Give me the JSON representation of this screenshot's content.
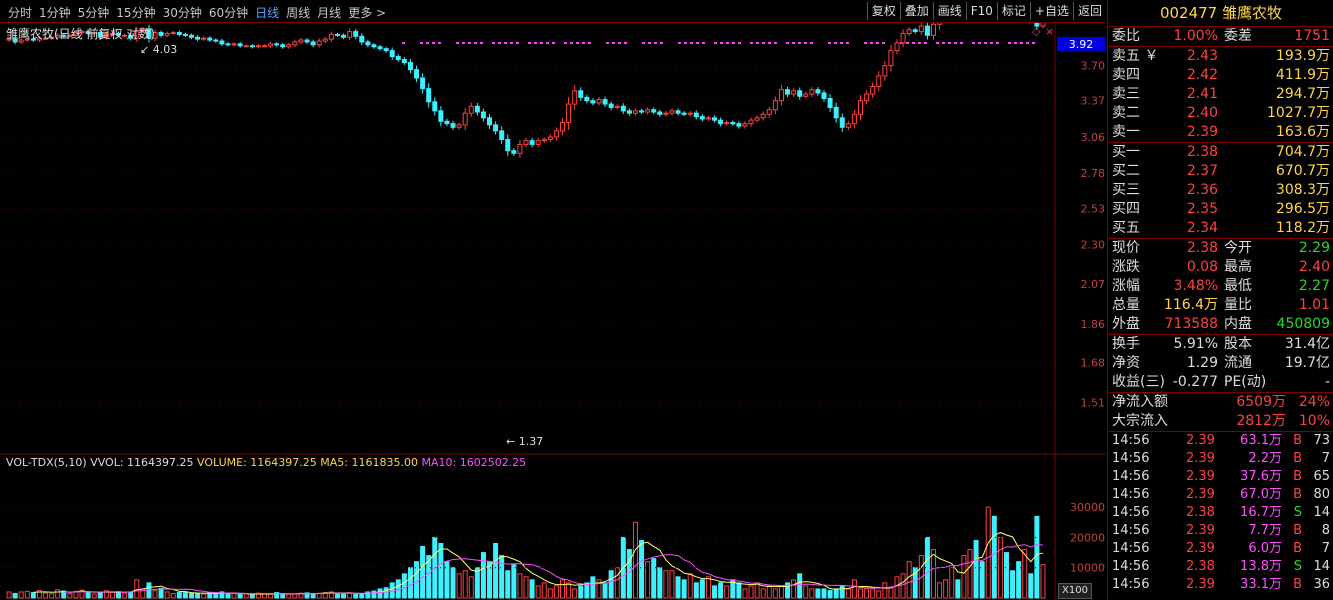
{
  "toolbar": {
    "periods": [
      "分时",
      "1分钟",
      "5分钟",
      "15分钟",
      "30分钟",
      "60分钟",
      "日线",
      "周线",
      "月线",
      "更多 >"
    ],
    "active": "日线",
    "buttons": [
      "复权",
      "叠加",
      "画线",
      "F10",
      "标记",
      "+自选",
      "返回"
    ]
  },
  "chart_label": "雏鹰农牧(日线 前复权 对数)",
  "price_axis": {
    "ticks": [
      "3.70",
      "3.37",
      "3.06",
      "2.78",
      "2.53",
      "2.30",
      "2.07",
      "1.86",
      "1.68",
      "1.51"
    ],
    "current_tag": "3.92"
  },
  "markers": {
    "high": "4.03",
    "low": "1.37"
  },
  "vol_label": {
    "name": "VOL-TDX(5,10)",
    "vvol": "VVOL: 1164397.25",
    "volume": "VOLUME: 1164397.25",
    "ma5": "MA5: 1161835.00",
    "ma10": "MA10: 1602502.25"
  },
  "vol_axis": {
    "ticks": [
      "30000",
      "20000",
      "10000"
    ],
    "multiplier": "X100"
  },
  "chart_data": {
    "type": "candlestick",
    "start": 3.96,
    "changes": [
      0.01,
      -0.03,
      0.02,
      0.01,
      -0.01,
      0.02,
      0,
      0.01,
      0.02,
      -0.01,
      0.01,
      0.03,
      0.01,
      -0.02,
      0.01,
      -0.05,
      0.03,
      0.01,
      -0.02,
      0,
      -0.03,
      0.08,
      0.02,
      -0.1,
      0.06,
      -0.03,
      0.02,
      0.01,
      -0.02,
      -0.01,
      -0.02,
      -0.02,
      0.01,
      -0.02,
      -0.01,
      -0.03,
      -0.01,
      0.01,
      -0.02,
      0,
      -0.01,
      0.01,
      0,
      0.02,
      -0.01,
      -0.02,
      0.02,
      0.03,
      0.02,
      -0.02,
      -0.03,
      0.04,
      0.02,
      0.05,
      -0.01,
      -0.02,
      0.06,
      -0.05,
      -0.06,
      -0.03,
      -0.02,
      -0.02,
      -0.02,
      -0.06,
      -0.03,
      -0.03,
      -0.07,
      -0.08,
      -0.1,
      -0.12,
      -0.08,
      -0.09,
      -0.02,
      -0.03,
      0.02,
      0.1,
      0.06,
      -0.05,
      -0.05,
      -0.06,
      -0.05,
      -0.07,
      -0.09,
      -0.02,
      0.07,
      0.03,
      -0.03,
      0.03,
      0.01,
      0.02,
      0.05,
      0.07,
      0.16,
      0.12,
      -0.06,
      -0.03,
      -0.02,
      0.03,
      -0.04,
      -0.03,
      0.01,
      -0.04,
      -0.02,
      0.02,
      -0.01,
      0.02,
      -0.02,
      -0.02,
      0.01,
      0.02,
      -0.02,
      -0.01,
      0.01,
      -0.03,
      -0.02,
      0.01,
      -0.02,
      -0.03,
      0.01,
      -0.01,
      -0.02,
      0.02,
      0.03,
      0.02,
      0.03,
      0.04,
      0.08,
      0.1,
      -0.04,
      0.03,
      -0.05,
      0.02,
      0.04,
      -0.03,
      -0.05,
      -0.08,
      -0.09,
      -0.08,
      0.03,
      0.08,
      0.12,
      0.06,
      0.07,
      0.1,
      0.1,
      0.15,
      0.08,
      0.1,
      0.04,
      -0.02,
      0.06,
      -0.1,
      0.12,
      0.15,
      0.1,
      0.12,
      -0.08,
      0.14,
      0.06,
      -0.15,
      -0.08,
      0.03,
      -0.05,
      0.02,
      -0.1,
      -0.04,
      -0.05,
      0.02,
      -0.03,
      -0.08,
      0.04
    ],
    "vols": [
      2,
      1.5,
      2,
      2.2,
      1.8,
      2.5,
      1.6,
      1.4,
      2.7,
      2.3,
      1.5,
      2.2,
      2.6,
      2,
      1.3,
      1.7,
      2.4,
      2,
      2.1,
      1.6,
      1.9,
      6,
      3,
      5,
      2.4,
      3.2,
      2,
      1.5,
      1.8,
      2,
      1.5,
      1.4,
      1.3,
      1.7,
      1.6,
      2,
      1.4,
      1.5,
      1.2,
      1.3,
      1.1,
      1.6,
      1.4,
      1.2,
      1.8,
      1.3,
      1.2,
      1.4,
      1.6,
      1.7,
      1.4,
      1.5,
      1.8,
      2,
      1.6,
      1.3,
      1.7,
      1.2,
      1.4,
      2,
      2.3,
      3,
      3.4,
      5,
      6,
      8,
      10,
      12,
      17,
      14,
      20,
      18,
      12,
      10,
      8,
      9,
      7,
      10,
      15,
      12,
      18,
      14,
      9,
      11,
      8,
      7,
      6,
      4,
      5,
      3,
      4,
      6,
      5,
      3,
      4,
      5,
      7,
      6,
      5,
      9,
      10,
      20,
      16,
      25,
      19,
      12,
      13,
      10,
      9,
      9,
      7,
      6,
      8,
      5,
      6,
      7,
      4,
      5,
      4,
      6,
      5,
      3,
      4,
      5,
      3,
      4,
      3,
      4,
      5,
      6,
      8,
      4,
      3,
      3,
      3,
      2.5,
      3,
      4,
      3,
      6,
      3,
      3,
      3,
      2.3,
      5,
      3.5,
      7,
      8,
      12,
      10,
      14,
      20,
      16,
      5,
      6,
      10,
      6,
      14,
      16,
      19,
      12,
      30,
      27,
      20,
      15,
      9,
      12,
      16,
      8,
      27,
      11,
      14,
      23,
      20,
      27,
      24,
      31,
      25,
      17,
      18,
      21,
      16,
      19,
      18,
      12,
      14,
      9,
      14,
      11,
      10
    ]
  },
  "panel": {
    "code": "002477",
    "name": "雏鹰农牧",
    "weibi": {
      "label": "委比",
      "pct": "1.00%",
      "label2": "委差",
      "val": "1751"
    },
    "sells": [
      {
        "label": "卖五",
        "flag": "￥",
        "price": "2.43",
        "vol": "193.9万"
      },
      {
        "label": "卖四",
        "price": "2.42",
        "vol": "411.9万"
      },
      {
        "label": "卖三",
        "price": "2.41",
        "vol": "294.7万"
      },
      {
        "label": "卖二",
        "price": "2.40",
        "vol": "1027.7万"
      },
      {
        "label": "卖一",
        "price": "2.39",
        "vol": "163.6万"
      }
    ],
    "buys": [
      {
        "label": "买一",
        "price": "2.38",
        "vol": "704.7万"
      },
      {
        "label": "买二",
        "price": "2.37",
        "vol": "670.7万"
      },
      {
        "label": "买三",
        "price": "2.36",
        "vol": "308.3万"
      },
      {
        "label": "买四",
        "price": "2.35",
        "vol": "296.5万"
      },
      {
        "label": "买五",
        "price": "2.34",
        "vol": "118.2万"
      }
    ],
    "quote": [
      [
        "现价",
        "2.38",
        "今开",
        "2.29"
      ],
      [
        "涨跌",
        "0.08",
        "最高",
        "2.40"
      ],
      [
        "涨幅",
        "3.48%",
        "最低",
        "2.27"
      ],
      [
        "总量",
        "116.4万",
        "量比",
        "1.01"
      ],
      [
        "外盘",
        "713588",
        "内盘",
        "450809"
      ]
    ],
    "fund": [
      [
        "换手",
        "5.91%",
        "股本",
        "31.4亿"
      ],
      [
        "净资",
        "1.29",
        "流通",
        "19.7亿"
      ],
      [
        "收益(三)",
        "-0.277",
        "PE(动)",
        "-"
      ]
    ],
    "flow": [
      [
        "净流入额",
        "6509万",
        "24%"
      ],
      [
        "大宗流入",
        "2812万",
        "10%"
      ]
    ],
    "ticks": [
      [
        "14:56",
        "2.39",
        "63.1万",
        "B",
        "73"
      ],
      [
        "14:56",
        "2.39",
        "2.2万",
        "B",
        "7"
      ],
      [
        "14:56",
        "2.39",
        "37.6万",
        "B",
        "65"
      ],
      [
        "14:56",
        "2.39",
        "67.0万",
        "B",
        "80"
      ],
      [
        "14:56",
        "2.38",
        "16.7万",
        "S",
        "14"
      ],
      [
        "14:56",
        "2.39",
        "7.7万",
        "B",
        "8"
      ],
      [
        "14:56",
        "2.39",
        "6.0万",
        "B",
        "7"
      ],
      [
        "14:56",
        "2.38",
        "13.8万",
        "S",
        "14"
      ],
      [
        "14:56",
        "2.39",
        "33.1万",
        "B",
        "36"
      ]
    ]
  },
  "colors": {
    "up": "#ff4040",
    "down": "#3cf0ff",
    "ma5": "#ffff70",
    "ma10": "#ff50ff",
    "grid": "#7a0000"
  }
}
